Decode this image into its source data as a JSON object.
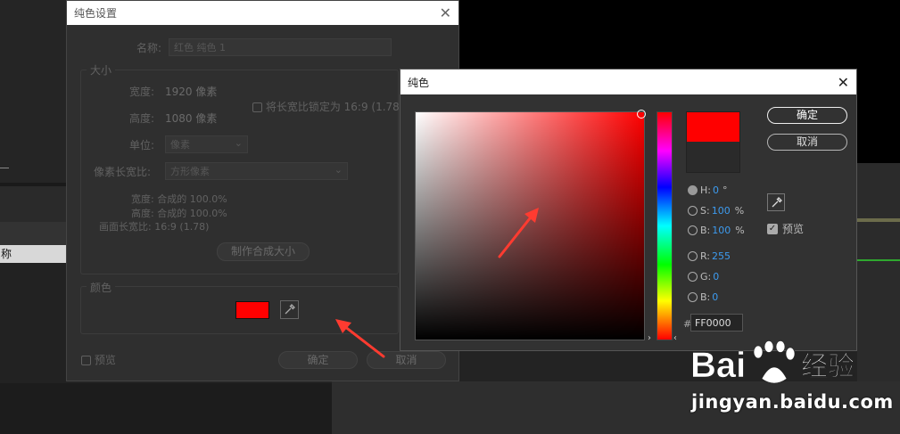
{
  "dialog_solid_settings": {
    "title": "纯色设置",
    "name_label": "名称:",
    "name_value": "红色 纯色 1",
    "size_group": "大小",
    "width_label": "宽度:",
    "width_value": "1920 像素",
    "height_label": "高度:",
    "height_value": "1080 像素",
    "lock_ratio_label": "将长宽比锁定为 16:9 (1.78)",
    "unit_label": "单位:",
    "unit_value": "像素",
    "pixel_aspect_label": "像素长宽比:",
    "pixel_aspect_value": "方形像素",
    "info_width": "宽度: 合成的 100.0%",
    "info_height": "高度: 合成的 100.0%",
    "info_frame_aspect": "画面长宽比: 16:9 (1.78)",
    "make_comp_size_button": "制作合成大小",
    "color_group": "颜色",
    "color_swatch": "#ff0000",
    "preview_label": "预览",
    "ok_button": "确定",
    "cancel_button": "取消"
  },
  "dialog_solid_color": {
    "title": "纯色",
    "ok_button": "确定",
    "cancel_button": "取消",
    "new_color": "#ff0000",
    "h_label": "H:",
    "h_value": "0",
    "h_unit": "°",
    "s_label": "S:",
    "s_value": "100",
    "s_unit": "%",
    "b_label": "B:",
    "b_value": "100",
    "b_unit": "%",
    "r_label": "R:",
    "r_value": "255",
    "g_label": "G:",
    "g_value": "0",
    "bl_label": "B:",
    "bl_value": "0",
    "hex_prefix": "#",
    "hex_value": "FF0000",
    "preview_label": "预览"
  },
  "background": {
    "panel_label": "称"
  },
  "watermark": {
    "brand": "Bai",
    "brand_cn": "经验",
    "url": "jingyan.baidu.com"
  },
  "icons": [
    "close-icon",
    "eyedropper-icon",
    "dropdown-chevron-icon",
    "checkmark-icon",
    "annotation-arrow"
  ]
}
